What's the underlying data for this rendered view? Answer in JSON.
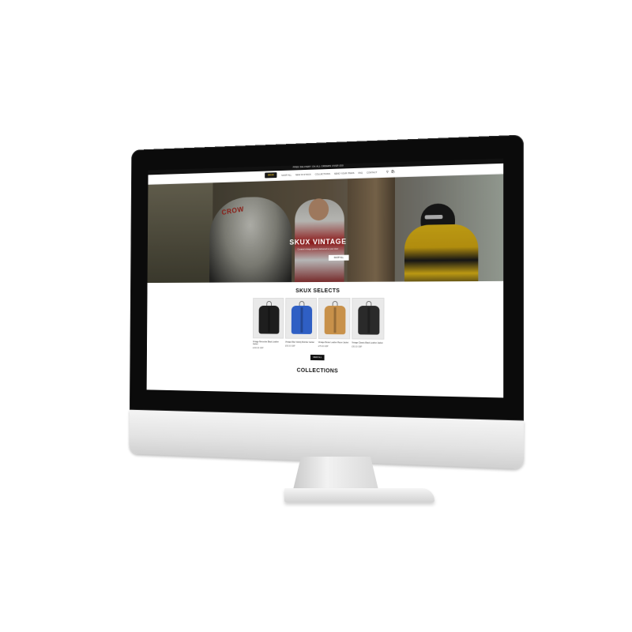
{
  "announcement": "FREE DELIVERY ON ALL ORDERS OVER £50",
  "nav": {
    "logo": "SKUX",
    "menu": [
      "SHOP ALL",
      "NEW IN STOCK",
      "COLLECTIONS",
      "SEND YOUR ITEMS",
      "FAQ",
      "CONTACT"
    ],
    "search_icon": "search-icon",
    "cart_icon": "cart-icon"
  },
  "hero": {
    "title": "SKUX VINTAGE",
    "subtitle": "Curated vintage jackets delivered to your door",
    "cta": "SHOP ALL",
    "jacket_text": "CROW"
  },
  "selects": {
    "title": "SKUX SELECTS",
    "products": [
      {
        "name": "Vintage Mercedes Black Leather Jacket",
        "price": "£160.00 GBP",
        "color": "#1e1e1e"
      },
      {
        "name": "Vintage Blue Varsity Bomber Jacket",
        "price": "£90.00 GBP",
        "color": "#2f5fc4"
      },
      {
        "name": "Vintage Brown Leather Racer Jacket",
        "price": "£75.00 GBP",
        "color": "#c8914a"
      },
      {
        "name": "Vintage Classic Black Leather Jacket",
        "price": "£90.00 GBP",
        "color": "#2a2a2a"
      }
    ],
    "view_all": "VIEW ALL"
  },
  "collections": {
    "title": "COLLECTIONS"
  },
  "colors": {
    "accent": "#f0c419",
    "dark": "#111111",
    "bezel": "#0b0b0b"
  }
}
